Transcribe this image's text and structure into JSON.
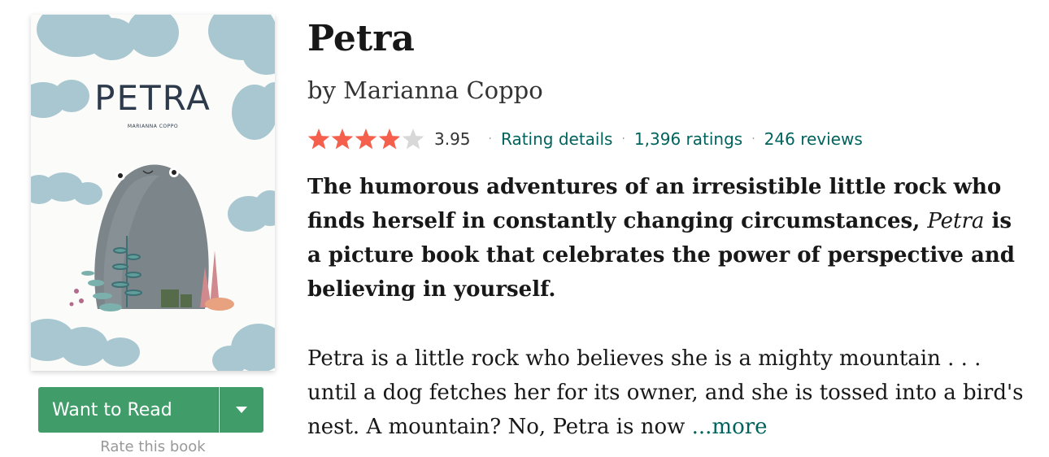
{
  "book": {
    "title": "Petra",
    "by": "by",
    "author": "Marianna Coppo"
  },
  "cover": {
    "title": "PETRA",
    "author": "MARIANNA COPPO"
  },
  "rating": {
    "stars_filled": 3.95,
    "stars_total": 5,
    "average": "3.95",
    "details_label": "Rating details",
    "ratings_label": "1,396 ratings",
    "reviews_label": "246 reviews",
    "separator": "·",
    "star_color": "#f4604c",
    "empty_star_color": "#d8d8d8"
  },
  "description": {
    "bold_part1": "The humorous adventures of an irresistible little rock who finds herself in constantly changing circumstances, ",
    "bold_italic": "Petra",
    "bold_part2": " is a picture book that celebrates the power of perspective and believing in yourself.",
    "body": "Petra is a little rock who believes she is a mighty mountain . . . until a dog fetches her for its owner, and she is tossed into a bird's nest. A mountain? No, Petra is now ",
    "more_label": "...more"
  },
  "shelf": {
    "want_to_read_label": "Want to Read",
    "rate_label": "Rate this book",
    "button_color": "#409d69"
  }
}
